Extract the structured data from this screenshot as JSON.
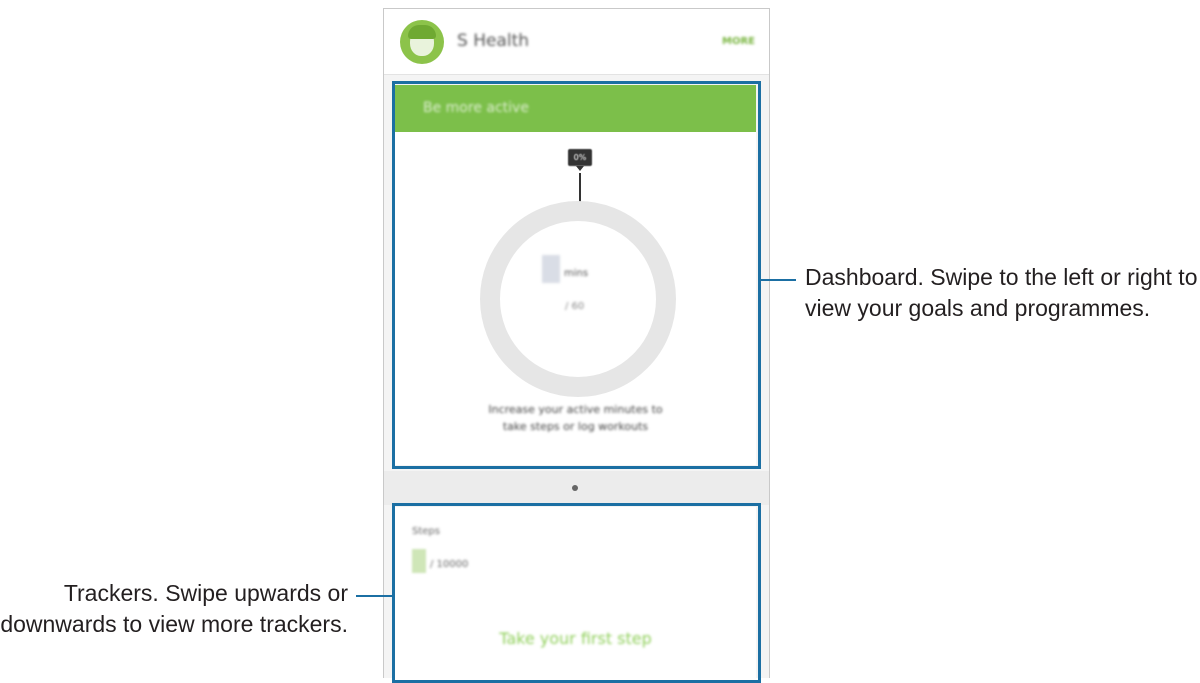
{
  "app": {
    "title": "S Health",
    "more_label": "MORE"
  },
  "dashboard": {
    "header": "Be more active",
    "tag": "0%",
    "value_unit": "mins",
    "target": "/ 60",
    "description_line1": "Increase your active minutes to",
    "description_line2": "take steps or log workouts"
  },
  "tracker": {
    "title": "Steps",
    "target": "/ 10000",
    "cta": "Take your first step"
  },
  "callouts": {
    "dashboard": "Dashboard. Swipe to the left or right to view your goals and programmes.",
    "trackers": "Trackers. Swipe upwards or downwards to view more trackers."
  },
  "colors": {
    "accent_green": "#7cbf4a",
    "highlight_blue": "#1b6fa3"
  },
  "icons": {
    "avatar": "profile-avatar-icon"
  }
}
